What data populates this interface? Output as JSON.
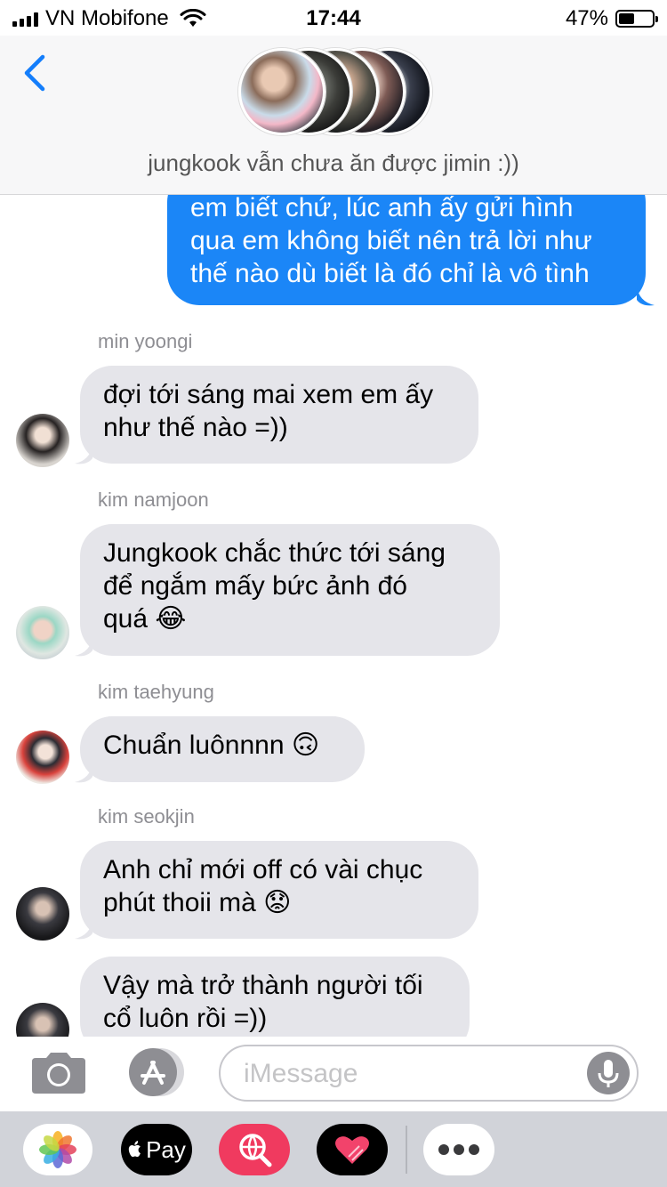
{
  "status_bar": {
    "carrier": "VN Mobifone",
    "time": "17:44",
    "battery_percent": "47%",
    "battery_level": 0.47
  },
  "header": {
    "group_name": "jungkook vẫn chưa ăn được jimin :))"
  },
  "messages": [
    {
      "direction": "outgoing",
      "lines": [
        "em biết chứ, lúc anh ấy gửi hình",
        "qua em không biết nên trả lời như",
        "thế nào dù biết là đó chỉ là vô tình"
      ]
    },
    {
      "direction": "incoming",
      "sender": "min yoongi",
      "lines": [
        "đợi tới sáng mai xem em ấy",
        "như thế nào =))"
      ]
    },
    {
      "direction": "incoming",
      "sender": "kim namjoon",
      "lines": [
        "Jungkook chắc thức tới sáng",
        "để ngắm mấy bức ảnh đó",
        "quá 😂"
      ]
    },
    {
      "direction": "incoming",
      "sender": "kim taehyung",
      "lines": [
        "Chuẩn luônnnn 🙃"
      ]
    },
    {
      "direction": "incoming",
      "sender": "kim seokjin",
      "lines": [
        "Anh chỉ mới off có vài chục",
        "phút thoii mà 😟"
      ]
    },
    {
      "direction": "incoming",
      "lines": [
        "Vậy mà trở thành người tối",
        "cổ luôn rồi =))"
      ]
    }
  ],
  "input_bar": {
    "placeholder": "iMessage"
  },
  "app_drawer": {
    "apple_pay_label": "Pay",
    "apps": [
      "photos-icon",
      "apple-pay-icon",
      "web-search-icon",
      "digital-touch-icon",
      "more-icon"
    ]
  },
  "colors": {
    "outgoing_bubble": "#1b86f7",
    "incoming_bubble": "#e5e5ea",
    "ios_blue": "#147efb"
  }
}
